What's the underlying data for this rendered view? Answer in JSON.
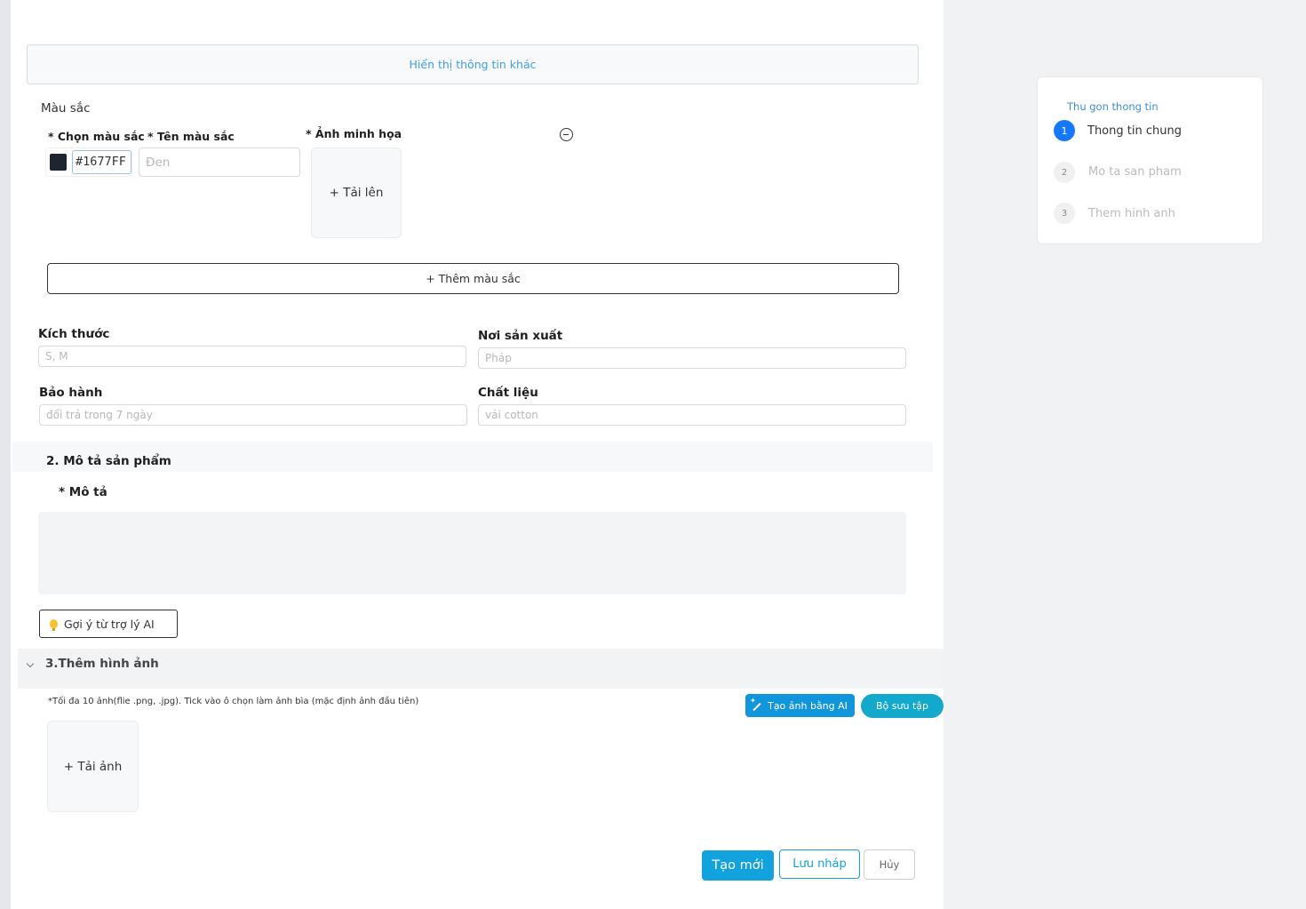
{
  "form": {
    "show_more_label": "Hiển thị thông tin khác",
    "color_section": {
      "title": "Màu sắc",
      "pick_color_label": "* Chọn màu sắc",
      "color_name_label": "* Tên màu sắc",
      "illustration_label": "* Ảnh  minh họa",
      "hex_value": "#1677FF",
      "swatch_color": "#1f2530",
      "name_placeholder": "Đen",
      "upload_label": "+ Tải lên",
      "add_color_label": "+ Thêm màu sắc"
    },
    "fields": {
      "size_label": "Kích thước",
      "size_placeholder": "S, M",
      "origin_label": "Nơi sản xuất",
      "origin_placeholder": "Pháp",
      "warranty_label": "Bảo hành",
      "warranty_placeholder": "đổi trả trong 7  ngày",
      "material_label": "Chất liệu",
      "material_placeholder": "vải cotton"
    },
    "section2": {
      "title": "2. Mô tả sản phẩm",
      "description_label": "* Mô tả",
      "ai_suggest_label": "Gợi ý từ trợ lý AI"
    },
    "section3": {
      "title": "3.Thêm hình ảnh",
      "note": "*Tối đa 10 ảnh(flie .png, .jpg). Tick vào ô chọn làm ảnh bìa (mặc định ảnh đầu tiên)",
      "ai_image_label": "Tạo ảnh bằng AI",
      "gallery_label": "Bộ sưu tập",
      "upload_image_label": "+ Tải ảnh"
    },
    "actions": {
      "create_label": "Tạo mới",
      "draft_label": "Lưu nháp",
      "cancel_label": "Hủy"
    }
  },
  "toc": {
    "collapse_label": "Thu gon thong tin",
    "steps": [
      {
        "number": "1",
        "label": "Thong tin chung"
      },
      {
        "number": "2",
        "label": "Mo ta san pham"
      },
      {
        "number": "3",
        "label": "Them hinh anh"
      }
    ]
  },
  "colors": {
    "accent": "#1677ff",
    "primary_button": "#12a3df",
    "link": "#3f9ee8"
  }
}
